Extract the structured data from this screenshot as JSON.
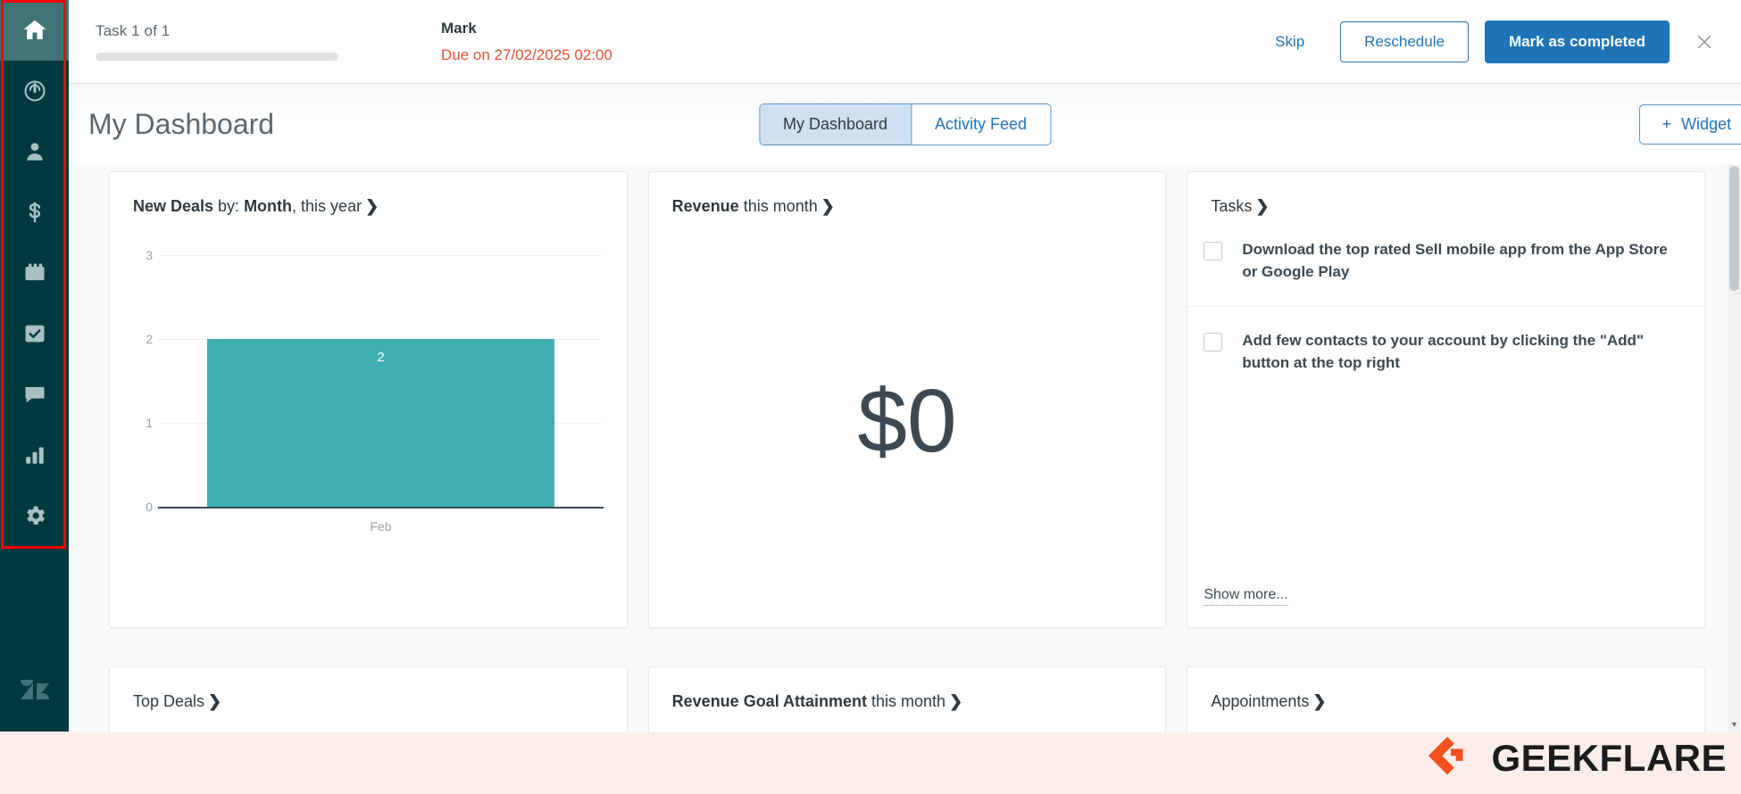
{
  "sidebar": {
    "items": [
      {
        "name": "home",
        "label": "Home",
        "active": true
      },
      {
        "name": "leads",
        "label": "Leads",
        "active": false
      },
      {
        "name": "contacts",
        "label": "Contacts",
        "active": false
      },
      {
        "name": "deals",
        "label": "Deals",
        "active": false
      },
      {
        "name": "calendar",
        "label": "Calendar",
        "active": false
      },
      {
        "name": "tasks",
        "label": "Tasks",
        "active": false
      },
      {
        "name": "communication",
        "label": "Communication",
        "active": false
      },
      {
        "name": "reports",
        "label": "Reports",
        "active": false
      },
      {
        "name": "settings",
        "label": "Settings",
        "active": false
      }
    ],
    "logo_label": "Zendesk"
  },
  "taskbar": {
    "counter": "Task 1 of 1",
    "task_name": "Mark",
    "due_text": "Due on 27/02/2025 02:00",
    "skip_label": "Skip",
    "reschedule_label": "Reschedule",
    "complete_label": "Mark as completed",
    "close_label": "✕",
    "due_color": "#e34f32",
    "primary_color": "#1f73b7"
  },
  "header": {
    "title": "My Dashboard",
    "tabs": [
      {
        "label": "My Dashboard",
        "active": true
      },
      {
        "label": "Activity Feed",
        "active": false
      }
    ],
    "widget_button": {
      "plus": "+",
      "label": "Widget"
    }
  },
  "widgets": {
    "new_deals": {
      "title_bold": "New Deals",
      "title_rest": " by: ",
      "title_bold2": "Month",
      "title_rest2": ", this year",
      "chevron": "❯"
    },
    "revenue": {
      "title_bold": "Revenue",
      "title_rest": " this month",
      "chevron": "❯",
      "value": "$0"
    },
    "tasks": {
      "title": "Tasks",
      "chevron": "❯",
      "items": [
        {
          "text": "Download the top rated Sell mobile app from the App Store or Google Play",
          "checked": false
        },
        {
          "text": "Add few contacts to your account by clicking the \"Add\" button at the top right",
          "checked": false
        }
      ],
      "show_more": "Show more..."
    },
    "top_deals": {
      "title": "Top Deals",
      "chevron": "❯"
    },
    "revenue_goal": {
      "title_bold": "Revenue Goal Attainment",
      "title_rest": " this month",
      "chevron": "❯"
    },
    "appointments": {
      "title": "Appointments",
      "chevron": "❯"
    }
  },
  "chart_data": {
    "type": "bar",
    "title": "New Deals by: Month, this year",
    "categories": [
      "Feb"
    ],
    "values": [
      2
    ],
    "data_labels": [
      "2"
    ],
    "ytick_labels": [
      "0",
      "1",
      "2",
      "3"
    ],
    "ylim": [
      0,
      3
    ],
    "xlabel": "",
    "ylabel": "",
    "grid": true,
    "legend": "none",
    "bar_color": "#41adb5"
  },
  "watermark": {
    "text": "GEEKFLARE"
  }
}
